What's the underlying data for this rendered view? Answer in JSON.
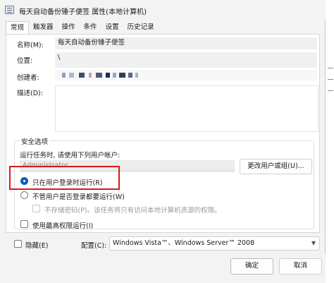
{
  "window": {
    "title": "每天自动备份锤子便签 属性(本地计算机)"
  },
  "tabs": [
    {
      "label": "常规",
      "active": true
    },
    {
      "label": "触发器",
      "active": false
    },
    {
      "label": "操作",
      "active": false
    },
    {
      "label": "条件",
      "active": false
    },
    {
      "label": "设置",
      "active": false
    },
    {
      "label": "历史记录",
      "active": false
    }
  ],
  "general": {
    "name_label": "名称(M):",
    "name_value": "每天自动备份锤子便签",
    "location_label": "位置:",
    "location_value": "\\",
    "author_label": "创建者:",
    "author_value_obscured": true,
    "description_label": "描述(D):",
    "description_value": ""
  },
  "security": {
    "group_label": "安全选项",
    "runas_prompt": "运行任务时, 请使用下列用户帐户:",
    "runas_user": "Administrator",
    "change_user_button": "更改用户或组(U)...",
    "radio_logged_on": "只在用户登录时运行(R)",
    "radio_logged_on_selected": true,
    "radio_whether_logged": "不管用户是否登录都要运行(W)",
    "radio_whether_logged_selected": false,
    "no_store_password": "不存储密码(P)。该任务将只有访问本地计算机资源的权限。",
    "no_store_password_checked": false,
    "no_store_password_enabled": false,
    "highest_privileges": "使用最高权限运行(I)",
    "highest_privileges_checked": false
  },
  "bottom": {
    "hidden_label": "隐藏(E)",
    "hidden_checked": false,
    "configure_label": "配置(C):",
    "configure_value": "Windows Vista™、Windows Server™ 2008"
  },
  "buttons": {
    "ok": "确定",
    "cancel": "取消"
  },
  "colors": {
    "accent": "#005fb8",
    "highlight_border": "#d31b1b"
  }
}
